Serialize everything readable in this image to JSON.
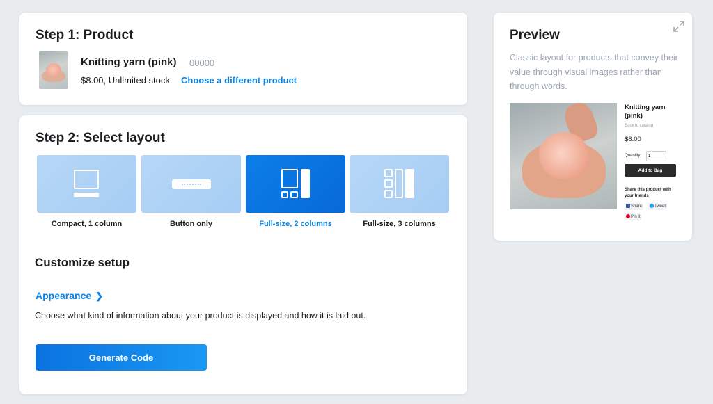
{
  "step1": {
    "title": "Step 1: Product",
    "product_name": "Knitting yarn (pink)",
    "sku": "00000",
    "price_stock": "$8.00, Unlimited stock",
    "change_link": "Choose a different product"
  },
  "step2": {
    "title": "Step 2: Select layout",
    "layouts": [
      {
        "label": "Compact, 1 column",
        "icon": "compact-layout-icon",
        "selected": false
      },
      {
        "label": "Button only",
        "icon": "button-layout-icon",
        "selected": false
      },
      {
        "label": "Full-size, 2 columns",
        "icon": "two-column-layout-icon",
        "selected": true
      },
      {
        "label": "Full-size, 3 columns",
        "icon": "three-column-layout-icon",
        "selected": false
      }
    ],
    "customize_title": "Customize setup",
    "appearance_link": "Appearance",
    "appearance_desc": "Choose what kind of information about your product is displayed and how it is laid out.",
    "generate_button": "Generate Code"
  },
  "preview": {
    "title": "Preview",
    "description": "Classic layout for products that convey their value through visual images rather than through words.",
    "product_title": "Knitting yarn (pink)",
    "back_link": "Back to catalog",
    "price": "$8.00",
    "quantity_label": "Quantity:",
    "quantity_value": "1",
    "add_to_bag": "Add to Bag",
    "share_text": "Share this product with your friends",
    "share_buttons": {
      "facebook": "Share",
      "twitter": "Tweet",
      "pinterest": "Pin it"
    }
  },
  "colors": {
    "accent": "#0a84e6",
    "tile_light": "#b6d7f6",
    "tile_selected": "#0d7ee8",
    "background": "#e9ecef",
    "muted_text": "#9aa3ad"
  }
}
